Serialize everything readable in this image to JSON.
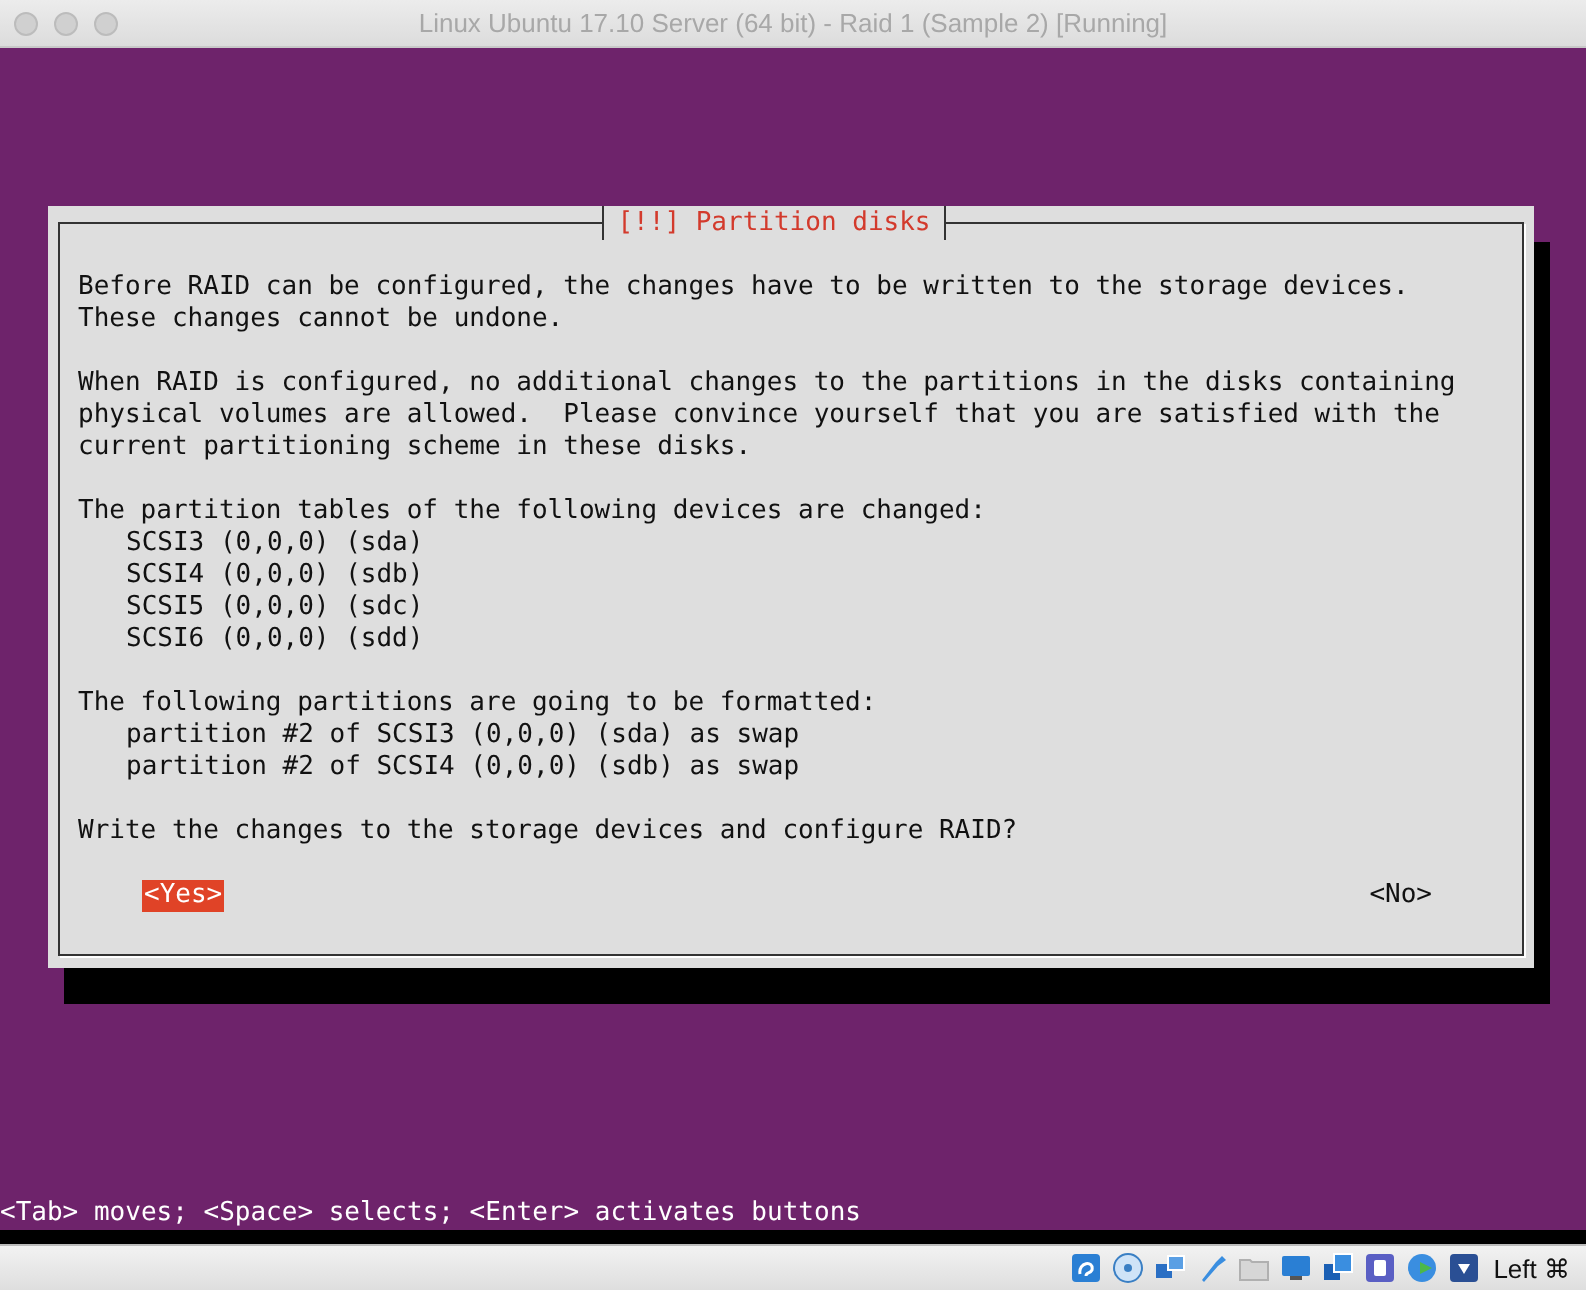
{
  "window": {
    "title": "Linux Ubuntu 17.10 Server (64 bit) - Raid 1 (Sample 2) [Running]"
  },
  "dialog": {
    "title": "[!!] Partition disks",
    "sections": [
      {
        "lines": [
          "Before RAID can be configured, the changes have to be written to the storage devices.",
          "These changes cannot be undone."
        ]
      },
      {
        "lines": [
          "When RAID is configured, no additional changes to the partitions in the disks containing",
          "physical volumes are allowed.  Please convince yourself that you are satisfied with the",
          "current partitioning scheme in these disks."
        ]
      },
      {
        "lines": [
          "The partition tables of the following devices are changed:"
        ],
        "items": [
          "SCSI3 (0,0,0) (sda)",
          "SCSI4 (0,0,0) (sdb)",
          "SCSI5 (0,0,0) (sdc)",
          "SCSI6 (0,0,0) (sdd)"
        ]
      },
      {
        "lines": [
          "The following partitions are going to be formatted:"
        ],
        "items": [
          "partition #2 of SCSI3 (0,0,0) (sda) as swap",
          "partition #2 of SCSI4 (0,0,0) (sdb) as swap"
        ]
      },
      {
        "lines": [
          "Write the changes to the storage devices and configure RAID?"
        ]
      }
    ],
    "buttons": [
      {
        "label": "<Yes>",
        "selected": true
      },
      {
        "label": "<No>",
        "selected": false
      }
    ]
  },
  "help_line": "<Tab> moves; <Space> selects; <Enter> activates buttons",
  "status_bar": {
    "host_key": "Left ⌘"
  }
}
